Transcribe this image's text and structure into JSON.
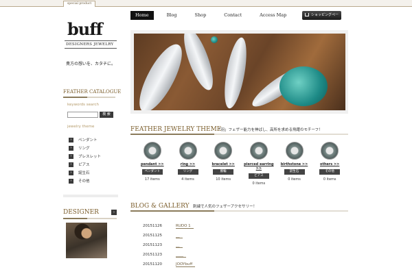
{
  "header": {
    "special_tag": "special product"
  },
  "logo": {
    "main": "buff",
    "sub": "DESIGNERS JEWELRY",
    "tagline": "貴方の想いを、カタチに。"
  },
  "sidebar": {
    "catalogue_title": "FEATHER CATALOGUE",
    "keywords_label": "keywords search",
    "search_value": "",
    "search_button": "検 索",
    "jewelry_theme_label": "jewelry theme",
    "categories": [
      {
        "label": "ペンダント"
      },
      {
        "label": "リング"
      },
      {
        "label": "ブレスレット"
      },
      {
        "label": "ピアス"
      },
      {
        "label": "誕生石"
      },
      {
        "label": "その他"
      }
    ],
    "designer_title": "DESIGNER",
    "designer_arrow": "›"
  },
  "nav": {
    "items": [
      {
        "label": "Home",
        "active": true
      },
      {
        "label": "Blog"
      },
      {
        "label": "Shop"
      },
      {
        "label": "Contact"
      },
      {
        "label": "Access Map"
      }
    ],
    "cart_label": "ショッピングページ"
  },
  "feather_theme": {
    "title": "FEATHER JEWELRY THEME",
    "note": "「羽」フェザー能力を伸ばし、高所を求める飛躍のモチーフ！",
    "items": [
      {
        "link": "pendant >>",
        "tag": "ペンダント",
        "count": "17 items"
      },
      {
        "link": "ring >>",
        "tag": "リング",
        "count": "4 items"
      },
      {
        "link": "bracelet >>",
        "tag": "腕輪",
        "count": "10 items"
      },
      {
        "link": "pierced earring >>",
        "tag": "ピアス",
        "count": "0 items"
      },
      {
        "link": "birthstone >>",
        "tag": "誕生石",
        "count": "0 items"
      },
      {
        "link": "others >>",
        "tag": "その他",
        "count": "0 items"
      }
    ]
  },
  "blog": {
    "title": "BLOG & GALLERY",
    "note": "刺繍で人気のフェザーアクセサリー！",
    "entries": [
      {
        "date": "20151126",
        "title": "RUDO 1"
      },
      {
        "date": "20151125",
        "title": "__"
      },
      {
        "date": "20151123",
        "title": "__"
      },
      {
        "date": "20151123",
        "title": "____"
      },
      {
        "date": "20151120",
        "title": "JOOYbuff"
      }
    ]
  }
}
